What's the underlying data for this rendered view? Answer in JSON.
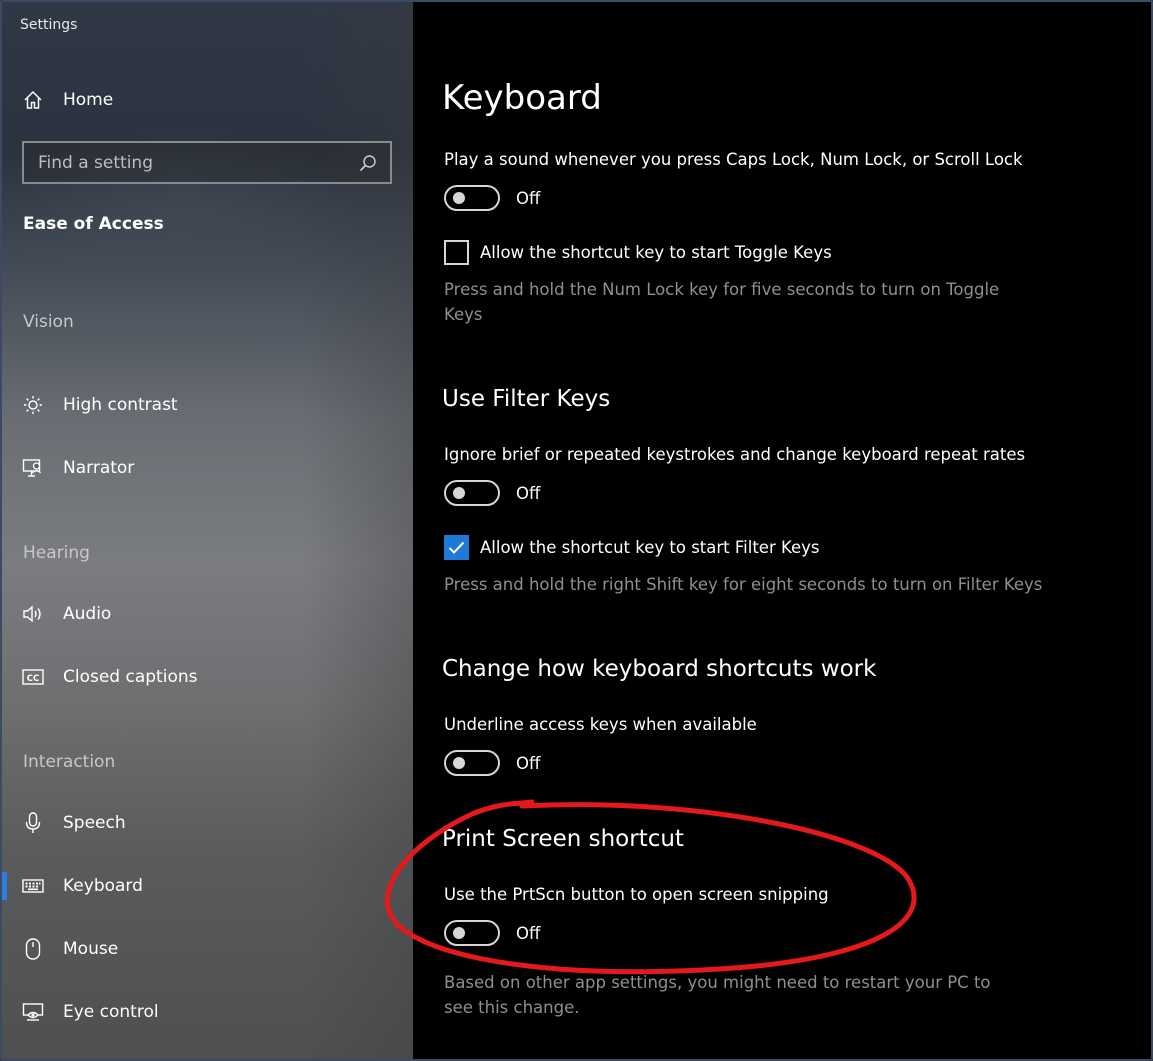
{
  "window": {
    "title": "Settings"
  },
  "sidebar": {
    "home_label": "Home",
    "search_placeholder": "Find a setting",
    "category": "Ease of Access",
    "sections": {
      "vision": "Vision",
      "hearing": "Hearing",
      "interaction": "Interaction"
    },
    "items": {
      "high_contrast": "High contrast",
      "narrator": "Narrator",
      "audio": "Audio",
      "closed_captions": "Closed captions",
      "speech": "Speech",
      "keyboard": "Keyboard",
      "mouse": "Mouse",
      "eye_control": "Eye control"
    },
    "active_item": "Keyboard",
    "accent_color": "#2f7de1"
  },
  "main": {
    "title": "Keyboard",
    "toggle_keys": {
      "sound_label": "Play a sound whenever you press Caps Lock, Num Lock, or Scroll Lock",
      "sound_state": "Off",
      "shortcut_label": "Allow the shortcut key to start Toggle Keys",
      "shortcut_checked": false,
      "shortcut_desc": "Press and hold the Num Lock key for five seconds to turn on Toggle Keys"
    },
    "filter_keys": {
      "heading": "Use Filter Keys",
      "label": "Ignore brief or repeated keystrokes and change keyboard repeat rates",
      "state": "Off",
      "shortcut_label": "Allow the shortcut key to start Filter Keys",
      "shortcut_checked": true,
      "shortcut_desc": "Press and hold the right Shift key for eight seconds to turn on Filter Keys"
    },
    "shortcuts": {
      "heading": "Change how keyboard shortcuts work",
      "label": "Underline access keys when available",
      "state": "Off"
    },
    "print_screen": {
      "heading": "Print Screen shortcut",
      "label": "Use the PrtScn button to open screen snipping",
      "state": "Off",
      "desc": "Based on other app settings, you might need to restart your PC to see this change."
    },
    "checkbox_color": "#1f7ad6",
    "annotation_color": "#e3191c"
  }
}
